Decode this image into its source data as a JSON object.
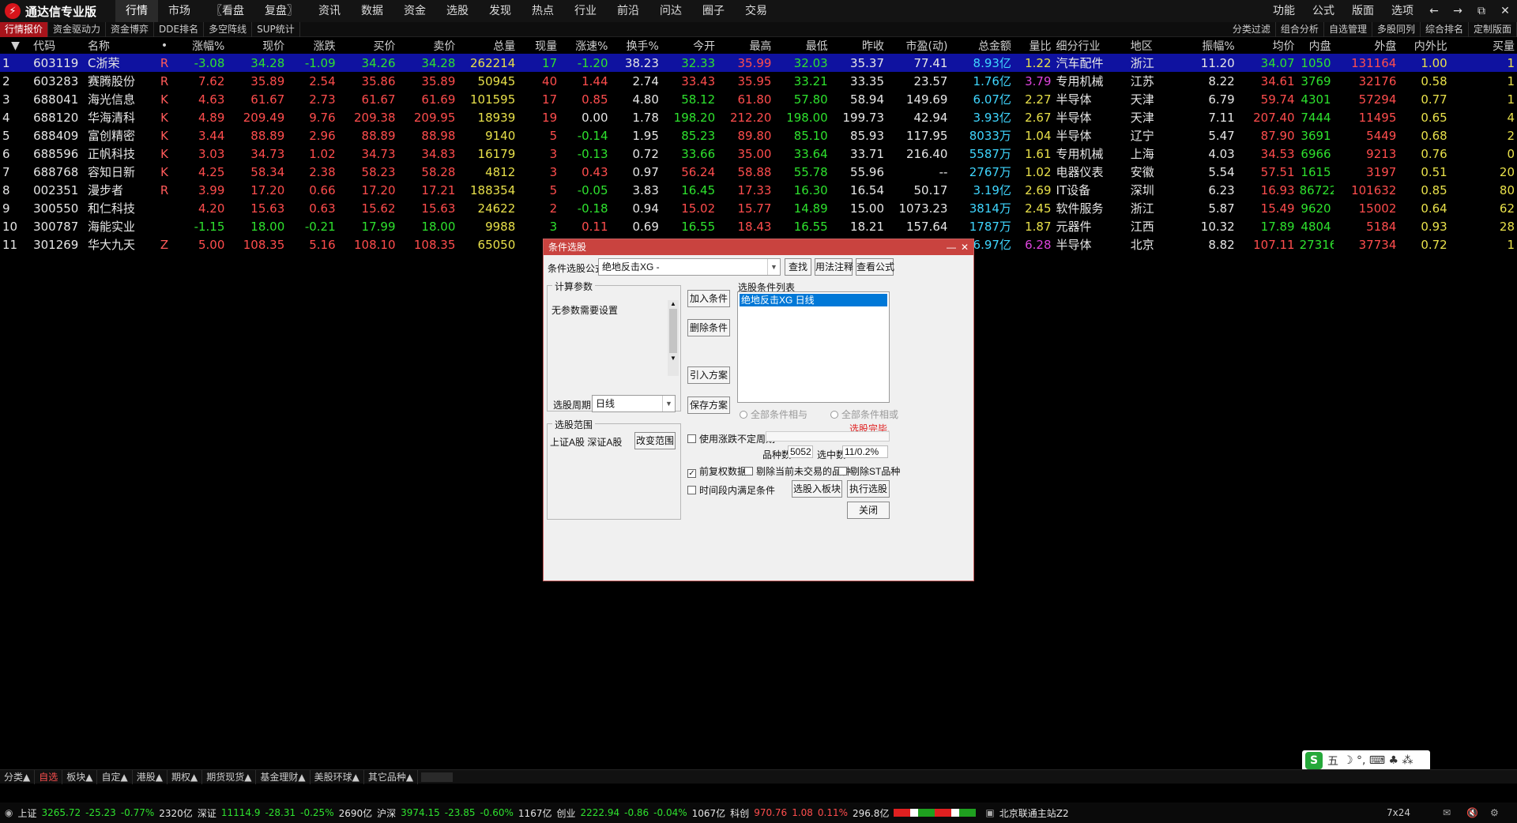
{
  "app": {
    "title": "通达信专业版"
  },
  "menu": [
    "行情",
    "市场",
    "〖看盘",
    "复盘〗",
    "资讯",
    "数据",
    "资金",
    "选股",
    "发现",
    "热点",
    "行业",
    "前沿",
    "问达",
    "圈子",
    "交易"
  ],
  "menu_right": [
    "功能",
    "公式",
    "版面",
    "选项"
  ],
  "window_controls": {
    "back": "←",
    "forward": "→",
    "restore": "⧉",
    "close": "✕"
  },
  "subtabs": [
    "行情报价",
    "资金驱动力",
    "资金博弈",
    "DDE排名",
    "多空阵线",
    "SUP统计"
  ],
  "subtabs_right": [
    "分类过滤",
    "组合分析",
    "自选管理",
    "多股同列",
    "综合排名",
    "定制版面"
  ],
  "columns": [
    "",
    "代码",
    "名称",
    "•",
    "",
    "涨幅%",
    "现价",
    "涨跌",
    "买价",
    "卖价",
    "总量",
    "现量",
    "涨速%",
    "换手%",
    "今开",
    "最高",
    "最低",
    "昨收",
    "市盈(动)",
    "总金额",
    "量比",
    "细分行业",
    "地区",
    "振幅%",
    "均价",
    "内盘",
    "外盘",
    "内外比",
    "买量"
  ],
  "rows": [
    [
      "1",
      "603119",
      "C浙荣",
      "R",
      "-3.08",
      "34.28",
      "-1.09",
      "34.26",
      "34.28",
      "262214",
      "17",
      "-1.20",
      "38.23",
      "32.33",
      "35.99",
      "32.03",
      "35.37",
      "77.41",
      "8.93亿",
      "1.22",
      "汽车配件",
      "浙江",
      "11.20",
      "34.07",
      "1050",
      "131164",
      "1.00",
      "1"
    ],
    [
      "2",
      "603283",
      "赛腾股份",
      "R",
      "7.62",
      "35.89",
      "2.54",
      "35.86",
      "35.89",
      "50945",
      "40",
      "1.44",
      "2.74",
      "33.43",
      "35.95",
      "33.21",
      "33.35",
      "23.57",
      "1.76亿",
      "3.79",
      "专用机械",
      "江苏",
      "8.22",
      "34.61",
      "3769",
      "32176",
      "0.58",
      "1"
    ],
    [
      "3",
      "688041",
      "海光信息",
      "K",
      "4.63",
      "61.67",
      "2.73",
      "61.67",
      "61.69",
      "101595",
      "17",
      "0.85",
      "4.80",
      "58.12",
      "61.80",
      "57.80",
      "58.94",
      "149.69",
      "6.07亿",
      "2.27",
      "半导体",
      "天津",
      "6.79",
      "59.74",
      "4301",
      "57294",
      "0.77",
      "1"
    ],
    [
      "4",
      "688120",
      "华海清科",
      "K",
      "4.89",
      "209.49",
      "9.76",
      "209.38",
      "209.95",
      "18939",
      "19",
      "0.00",
      "1.78",
      "198.20",
      "212.20",
      "198.00",
      "199.73",
      "42.94",
      "3.93亿",
      "2.67",
      "半导体",
      "天津",
      "7.11",
      "207.40",
      "7444",
      "11495",
      "0.65",
      "4"
    ],
    [
      "5",
      "688409",
      "富创精密",
      "K",
      "3.44",
      "88.89",
      "2.96",
      "88.89",
      "88.98",
      "9140",
      "5",
      "-0.14",
      "1.95",
      "85.23",
      "89.80",
      "85.10",
      "85.93",
      "117.95",
      "8033万",
      "1.04",
      "半导体",
      "辽宁",
      "5.47",
      "87.90",
      "3691",
      "5449",
      "0.68",
      "2"
    ],
    [
      "6",
      "688596",
      "正帆科技",
      "K",
      "3.03",
      "34.73",
      "1.02",
      "34.73",
      "34.83",
      "16179",
      "3",
      "-0.13",
      "0.72",
      "33.66",
      "35.00",
      "33.64",
      "33.71",
      "216.40",
      "5587万",
      "1.61",
      "专用机械",
      "上海",
      "4.03",
      "34.53",
      "6966",
      "9213",
      "0.76",
      "0"
    ],
    [
      "7",
      "688768",
      "容知日新",
      "K",
      "4.25",
      "58.34",
      "2.38",
      "58.23",
      "58.28",
      "4812",
      "3",
      "0.43",
      "0.97",
      "56.24",
      "58.88",
      "55.78",
      "55.96",
      "--",
      "2767万",
      "1.02",
      "电器仪表",
      "安徽",
      "5.54",
      "57.51",
      "1615",
      "3197",
      "0.51",
      "20"
    ],
    [
      "8",
      "002351",
      "漫步者",
      "R",
      "3.99",
      "17.20",
      "0.66",
      "17.20",
      "17.21",
      "188354",
      "5",
      "-0.05",
      "3.83",
      "16.45",
      "17.33",
      "16.30",
      "16.54",
      "50.17",
      "3.19亿",
      "2.69",
      "IT设备",
      "深圳",
      "6.23",
      "16.93",
      "86722",
      "101632",
      "0.85",
      "80"
    ],
    [
      "9",
      "300550",
      "和仁科技",
      "",
      "4.20",
      "15.63",
      "0.63",
      "15.62",
      "15.63",
      "24622",
      "2",
      "-0.18",
      "0.94",
      "15.02",
      "15.77",
      "14.89",
      "15.00",
      "1073.23",
      "3814万",
      "2.45",
      "软件服务",
      "浙江",
      "5.87",
      "15.49",
      "9620",
      "15002",
      "0.64",
      "62"
    ],
    [
      "10",
      "300787",
      "海能实业",
      "",
      "-1.15",
      "18.00",
      "-0.21",
      "17.99",
      "18.00",
      "9988",
      "3",
      "0.11",
      "0.69",
      "16.55",
      "18.43",
      "16.55",
      "18.21",
      "157.64",
      "1787万",
      "1.87",
      "元器件",
      "江西",
      "10.32",
      "17.89",
      "4804",
      "5184",
      "0.93",
      "28"
    ],
    [
      "11",
      "301269",
      "华大九天",
      "Z",
      "5.00",
      "108.35",
      "5.16",
      "108.10",
      "108.35",
      "65050",
      "",
      "",
      "",
      "",
      "",
      "",
      "",
      "",
      "6.97亿",
      "6.28",
      "半导体",
      "北京",
      "8.82",
      "107.11",
      "27316",
      "37734",
      "0.72",
      "1"
    ]
  ],
  "dialog": {
    "title": "条件选股",
    "minimize": "—",
    "close": "✕",
    "formula_label": "条件选股公式",
    "formula_value": "绝地反击XG  -",
    "btn_find": "查找",
    "btn_usage": "用法注释",
    "btn_view": "查看公式",
    "params_title": "计算参数",
    "params_text": "无参数需要设置",
    "period_label": "选股周期:",
    "period_value": "日线",
    "btn_add": "加入条件",
    "btn_delete": "删除条件",
    "btn_import": "引入方案",
    "btn_save": "保存方案",
    "list_title": "选股条件列表",
    "list_items": [
      "绝地反击XG  日线"
    ],
    "radio_and": "全部条件相与",
    "radio_or": "全部条件相或",
    "done": "选股完毕.",
    "scope_title": "选股范围",
    "scope_text": "上证A股 深证A股",
    "btn_scope": "改变范围",
    "chk_range": "使用涨跌不定周期",
    "count_label": "品种数",
    "count_value": "5052",
    "selected_label": "选中数",
    "selected_value": "11/0.2%",
    "chk_adjust": "前复权数据",
    "chk_exclude": "剔除当前未交易的品种",
    "chk_st": "剔除ST品种",
    "chk_time": "时间段内满足条件",
    "btn_to_block": "选股入板块",
    "btn_run": "执行选股",
    "btn_close": "关闭"
  },
  "bottom_tabs": [
    "分类▲",
    "自选",
    "板块▲",
    "自定▲",
    "港股▲",
    "期权▲",
    "期货现货▲",
    "基金理财▲",
    "美股环球▲",
    "其它品种▲"
  ],
  "status": {
    "sh_label": "上证",
    "sh_value": "3265.72",
    "sh_change": "-25.23",
    "sh_pct": "-0.77%",
    "sh_amt": "2320亿",
    "sz_label": "深证",
    "sz_value": "11114.9",
    "sz_change": "-28.31",
    "sz_pct": "-0.25%",
    "sz_amt": "2690亿",
    "hs_label": "沪深",
    "hs_value": "3974.15",
    "hs_change": "-23.85",
    "hs_pct": "-0.60%",
    "hs_amt": "1167亿",
    "cy_label": "创业",
    "cy_value": "2222.94",
    "cy_change": "-0.86",
    "cy_pct": "-0.04%",
    "cy_amt": "1067亿",
    "kc_label": "科创",
    "kc_value": "970.76",
    "kc_change": "1.08",
    "kc_pct": "0.11%",
    "kc_amt": "296.8亿",
    "server": "北京联通主站Z2",
    "clock": "7x24"
  },
  "ime": {
    "brand": "S",
    "mode": "五",
    "icons": "☽ °, ⌨ ♣ ⁂"
  },
  "colors": {
    "up": "#ff4d4d",
    "down": "#2ee22e",
    "selected_row": "#0f12a0",
    "dialog_title": "#c9433f"
  }
}
